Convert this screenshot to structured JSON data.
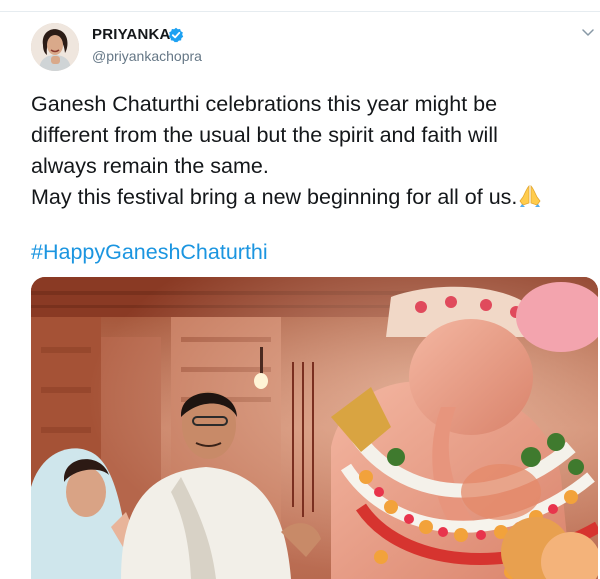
{
  "tweet": {
    "author": {
      "display_name": "PRIYANKA",
      "username": "@priyankachopra",
      "verified": true,
      "avatar_icon": "profile-photo"
    },
    "text_lines": [
      "Ganesh Chaturthi celebrations this year might be",
      "different from the usual but the spirit and faith will",
      "always remain the same.",
      "May this festival bring a new beginning for all of us."
    ],
    "emoji": "folded-hands",
    "hashtag": "#HappyGaneshChaturthi",
    "media": {
      "type": "photo",
      "subject": "ganesh-idol-worship"
    }
  },
  "colors": {
    "text": "#14171a",
    "secondary": "#657786",
    "link": "#1b95e0",
    "verified": "#1da1f2",
    "divider": "#e6ecf0"
  },
  "icons": {
    "verified": "verified-badge-icon",
    "menu": "chevron-down-icon"
  }
}
